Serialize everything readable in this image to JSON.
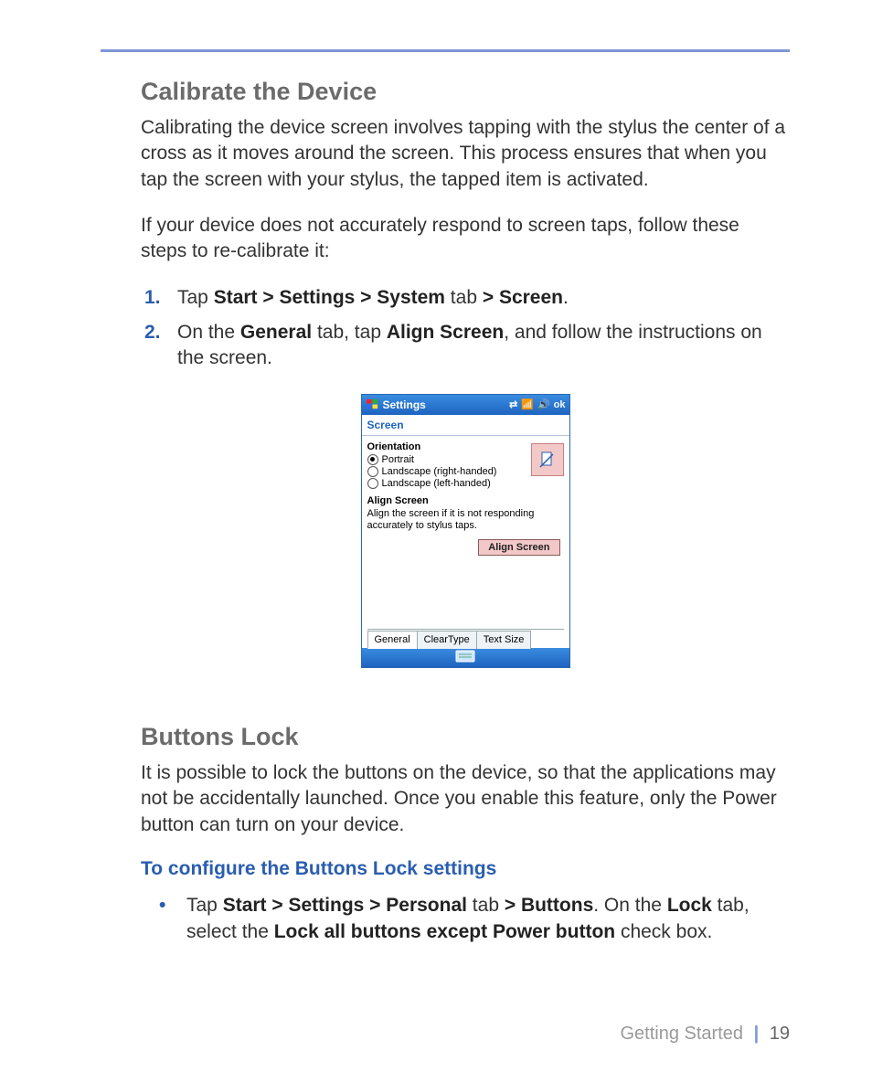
{
  "section1": {
    "title": "Calibrate the Device",
    "p1": "Calibrating the device screen involves tapping with the stylus the center of a cross as it moves around the screen. This process ensures that when you tap the screen with your stylus, the tapped item is activated.",
    "p2": "If your device does not accurately respond to screen taps, follow these steps to re-calibrate it:",
    "step1_num": "1.",
    "step1_a": "Tap ",
    "step1_b": "Start > Settings > System",
    "step1_c": " tab ",
    "step1_d": "> Screen",
    "step1_e": ".",
    "step2_num": "2.",
    "step2_a": "On the ",
    "step2_b": "General",
    "step2_c": " tab, tap ",
    "step2_d": "Align Screen",
    "step2_e": ", and follow the instructions on the screen."
  },
  "device": {
    "topbar_title": "Settings",
    "ok": "ok",
    "subbar": "Screen",
    "orientation_label": "Orientation",
    "radio1": "Portrait",
    "radio2": "Landscape (right-handed)",
    "radio3": "Landscape (left-handed)",
    "align_label": "Align Screen",
    "align_desc": "Align the screen if it is not responding accurately to stylus taps.",
    "align_btn": "Align Screen",
    "tab1": "General",
    "tab2": "ClearType",
    "tab3": "Text Size"
  },
  "section2": {
    "title": "Buttons Lock",
    "p1": "It is possible to lock the buttons on the device, so that the applications may not be accidentally launched. Once you enable this feature, only the Power button can turn on your device.",
    "subhead": "To configure the Buttons Lock settings",
    "bullet_a": "Tap ",
    "bullet_b": "Start > Settings > Personal",
    "bullet_c": " tab ",
    "bullet_d": "> Buttons",
    "bullet_e": ". On the ",
    "bullet_f": "Lock",
    "bullet_g": " tab, select the ",
    "bullet_h": "Lock all buttons except Power button",
    "bullet_i": " check box."
  },
  "footer": {
    "chapter": "Getting Started",
    "page": "19"
  }
}
